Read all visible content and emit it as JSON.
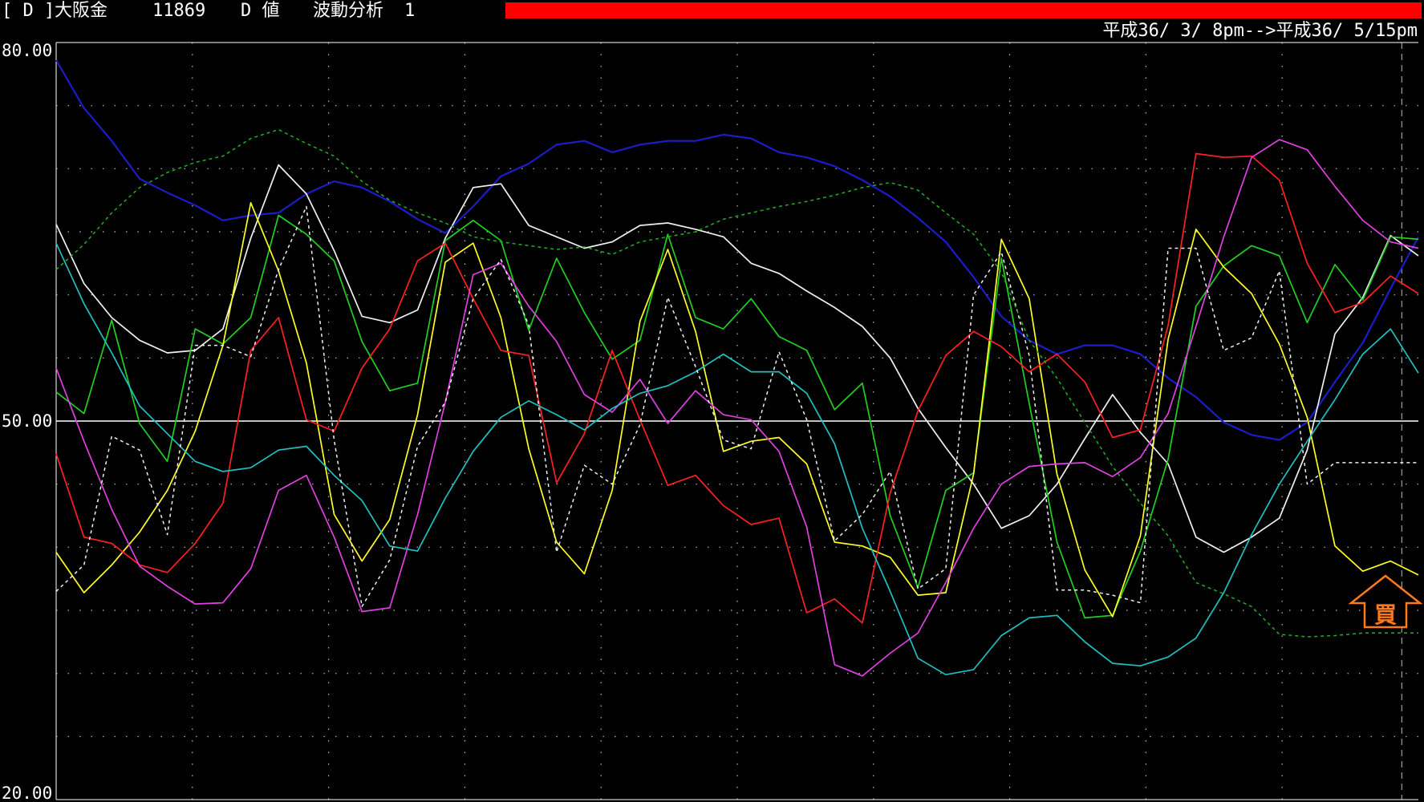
{
  "header": {
    "code": "[ D ]",
    "name": "大阪金",
    "value": "11869",
    "mode": "D 値",
    "tool": "波動分析",
    "suffix": "1",
    "date_range": "平成36/ 3/ 8pm-->平成36/ 5/15pm"
  },
  "signal": {
    "icon": "buy-arrow-icon",
    "label": "買",
    "color": "#ff7a1a"
  },
  "colors": {
    "background": "#000000",
    "accent": "#ff0000"
  },
  "chart_data": {
    "type": "line",
    "ylim": [
      20,
      80
    ],
    "y_ticks": [
      "80.00",
      "50.00",
      "20.00"
    ],
    "midline": 50,
    "grid": "dotted",
    "x": [
      0,
      1,
      2,
      3,
      4,
      5,
      6,
      7,
      8,
      9,
      10,
      11,
      12,
      13,
      14,
      15,
      16,
      17,
      18,
      19,
      20,
      21,
      22,
      23,
      24,
      25,
      26,
      27,
      28,
      29,
      30,
      31,
      32,
      33,
      34,
      35,
      36,
      37,
      38,
      39,
      40,
      41,
      42,
      43,
      44,
      45,
      46,
      47,
      48,
      49
    ],
    "series": [
      {
        "color": "#1c1cc8",
        "dashed": false,
        "values": [
          78.6,
          74.8,
          72.2,
          69.2,
          68.1,
          67.1,
          65.9,
          66.3,
          66.5,
          68,
          69,
          68.5,
          67.4,
          66,
          64.9,
          67,
          69.4,
          70.4,
          71.9,
          72.2,
          71.3,
          71.9,
          72.2,
          72.2,
          72.7,
          72.4,
          71.3,
          70.9,
          70.2,
          69.1,
          67.8,
          66.1,
          64.2,
          61.4,
          58.3,
          56.4,
          55.3,
          56,
          56,
          55.3,
          53.4,
          51.9,
          49.9,
          48.9,
          48.5,
          49.9,
          53.1,
          56.2,
          60.5,
          64.6
        ]
      },
      {
        "color": "#f0f0f0",
        "dashed": false,
        "values": [
          65.6,
          60.9,
          58.2,
          56.4,
          55.4,
          55.6,
          57.3,
          64.5,
          70.3,
          68,
          63.5,
          58.3,
          57.8,
          58.8,
          64.5,
          68.5,
          68.8,
          65.5,
          64.6,
          63.7,
          64.2,
          65.5,
          65.7,
          65.2,
          64.6,
          62.5,
          61.7,
          60.3,
          59,
          57.5,
          55,
          51,
          47.9,
          45,
          41.5,
          42.5,
          45,
          48.6,
          52.1,
          49.1,
          46.6,
          40.8,
          39.6,
          40.8,
          42.3,
          47.7,
          56.9,
          59.8,
          64.7,
          63.1
        ]
      },
      {
        "color": "#20d020",
        "dashed": false,
        "values": [
          52.3,
          50.6,
          58,
          49.8,
          46.8,
          57.3,
          56.1,
          58.2,
          66.3,
          64.8,
          62.7,
          56.3,
          52.4,
          53,
          64.3,
          65.9,
          64.3,
          57.2,
          62.9,
          58.6,
          54.9,
          56.4,
          64.8,
          58.2,
          57.3,
          59.7,
          56.7,
          55.6,
          50.9,
          53,
          42.5,
          36.8,
          44.5,
          45.9,
          62.9,
          51.4,
          40.4,
          34.4,
          34.6,
          39.7,
          47,
          59.1,
          62.3,
          63.9,
          63.1,
          57.8,
          62.4,
          59.6,
          64.6,
          64.4
        ]
      },
      {
        "color": "#ffff20",
        "dashed": false,
        "values": [
          39.6,
          36.4,
          38.6,
          41.2,
          44.5,
          49.2,
          56,
          67.3,
          61.9,
          54.6,
          42.6,
          38.9,
          42.2,
          50.5,
          62.6,
          64.1,
          58.2,
          47.8,
          40.4,
          37.9,
          44.5,
          57.9,
          63.6,
          57.1,
          47.6,
          48.4,
          48.7,
          46.6,
          40.4,
          40.1,
          39.2,
          36.2,
          36.4,
          45.8,
          64.4,
          59.7,
          45.8,
          38.2,
          34.5,
          40.9,
          56.5,
          65.2,
          62.2,
          60.1,
          56.1,
          50.3,
          40.1,
          38.1,
          38.9,
          37.8
        ]
      },
      {
        "color": "#ff2020",
        "dashed": false,
        "values": [
          47.4,
          40.8,
          40.3,
          38.6,
          38,
          40.3,
          43.5,
          55.6,
          58.2,
          50.1,
          49.2,
          54.2,
          57.3,
          62.7,
          64.1,
          59.7,
          55.6,
          55.2,
          45.1,
          49,
          55.6,
          50.1,
          44.9,
          45.7,
          43.3,
          41.8,
          42.3,
          34.8,
          35.9,
          34,
          44.3,
          50.8,
          55.2,
          57.1,
          55.9,
          53.9,
          55.3,
          53.1,
          48.7,
          49.3,
          57.6,
          71.2,
          70.9,
          71,
          69.1,
          62.5,
          58.6,
          59.4,
          61.5,
          60.1
        ]
      },
      {
        "color": "#e040e0",
        "dashed": false,
        "values": [
          54.2,
          48.4,
          43,
          38.5,
          36.9,
          35.5,
          35.6,
          38.3,
          44.5,
          45.7,
          40.8,
          34.9,
          35.2,
          42.6,
          51.5,
          61.6,
          62.5,
          59.1,
          56.3,
          52.1,
          50.7,
          53.3,
          49.8,
          52.4,
          50.5,
          50.1,
          47.6,
          41.6,
          30.7,
          29.8,
          31.6,
          33.2,
          37.2,
          41.5,
          45,
          46.4,
          46.6,
          46.7,
          45.6,
          47.1,
          50.6,
          57.5,
          64.6,
          70.9,
          72.3,
          71.5,
          68.6,
          65.9,
          64.2,
          63.7
        ]
      },
      {
        "color": "#20c0c0",
        "dashed": false,
        "values": [
          64.1,
          59.3,
          55.4,
          51.2,
          49,
          46.8,
          46,
          46.3,
          47.7,
          48,
          45.7,
          43.7,
          40.1,
          39.7,
          43.9,
          47.6,
          50.3,
          51.6,
          50.5,
          49.3,
          51,
          52.2,
          52.8,
          53.9,
          55.3,
          53.9,
          53.9,
          52.2,
          48.2,
          41.5,
          36.5,
          31.2,
          29.9,
          30.3,
          33,
          34.4,
          34.6,
          32.5,
          30.8,
          30.6,
          31.3,
          32.8,
          36.4,
          41,
          45,
          48.4,
          51.7,
          55.3,
          57.3,
          53.8
        ]
      },
      {
        "color": "#f0f0f0",
        "dashed": true,
        "values": [
          36.5,
          38.6,
          48.8,
          47.7,
          41,
          56,
          56,
          55.1,
          62,
          67,
          48.5,
          35.3,
          39,
          48,
          51.5,
          59.7,
          62.8,
          57.6,
          39.6,
          46.5,
          45,
          49.7,
          59.8,
          54.3,
          48.5,
          47.8,
          55.5,
          50.1,
          40.5,
          42.6,
          46,
          36.7,
          38.3,
          60,
          63.4,
          55.2,
          36.6,
          36.6,
          36.2,
          35.6,
          63.7,
          63.7,
          55.6,
          56.6,
          61.9,
          45,
          46.7,
          46.7,
          46.7,
          46.7
        ]
      },
      {
        "color": "#20b020",
        "dashed": true,
        "values": [
          62,
          64,
          66.5,
          68.5,
          69.7,
          70.5,
          71,
          72.4,
          73.1,
          72,
          71,
          69,
          67.5,
          66.5,
          65.7,
          64.6,
          64.2,
          63.9,
          63.6,
          63.8,
          63.2,
          64.2,
          64.6,
          65,
          66,
          66.5,
          67,
          67.4,
          67.9,
          68.5,
          68.9,
          68.3,
          66.5,
          64.8,
          61.8,
          56.4,
          53.4,
          49.9,
          46.4,
          43.5,
          40.9,
          37.2,
          36.3,
          35.3,
          33.1,
          32.9,
          33,
          33.2,
          33.2,
          33.2
        ]
      }
    ]
  }
}
